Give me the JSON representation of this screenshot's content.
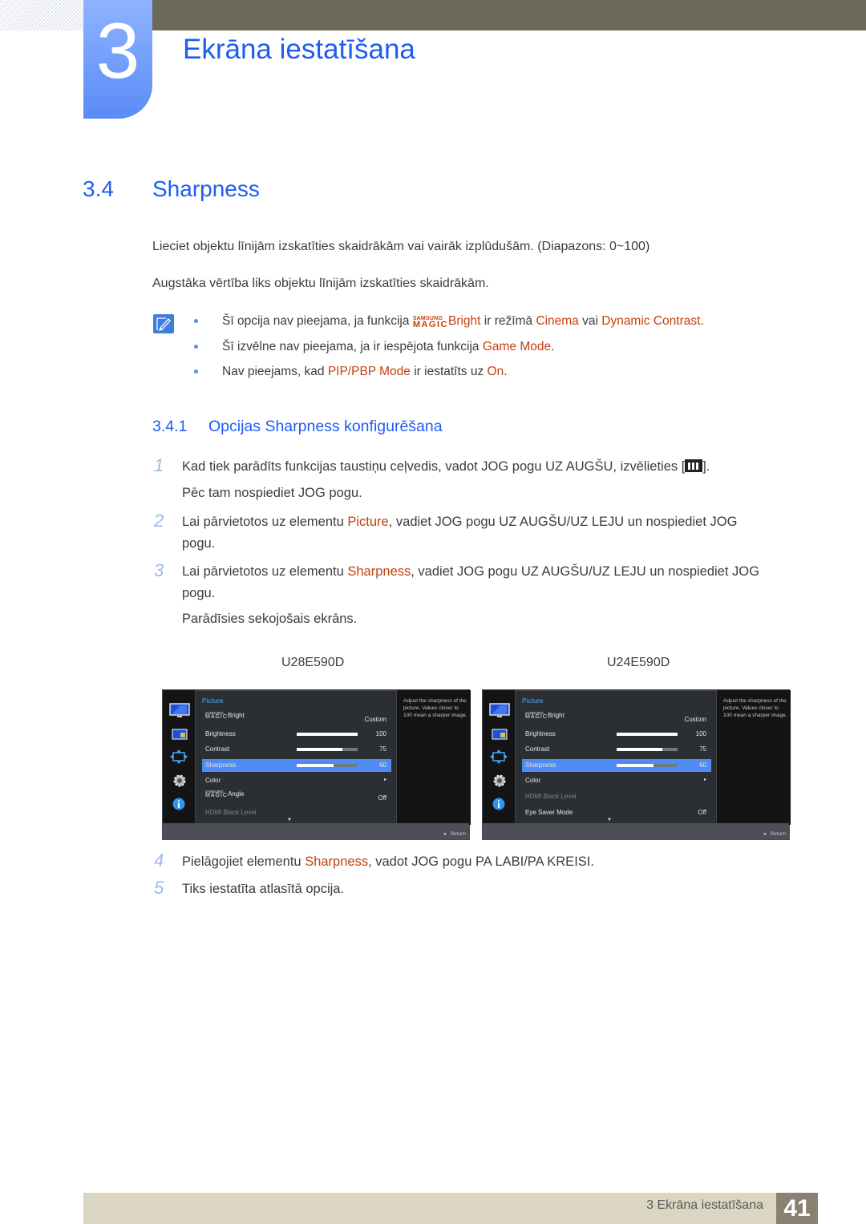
{
  "header": {
    "chapter_number": "3",
    "chapter_title": "Ekrāna iestatīšana"
  },
  "section": {
    "number": "3.4",
    "title": "Sharpness",
    "paragraphs": [
      "Lieciet objektu līnijām izskatīties skaidrākām vai vairāk izplūdušām. (Diapazons: 0~100)",
      "Augstāka vērtība liks objektu līnijām izskatīties skaidrākām."
    ]
  },
  "notes": {
    "icon": "note-pencil-icon",
    "items": [
      {
        "pre": "Šī opcija nav pieejama, ja funkcija ",
        "magic_top": "SAMSUNG",
        "magic_bottom": "MAGIC",
        "hl1": "Bright",
        "mid": " ir režīmā ",
        "hl2": "Cinema",
        "mid2": " vai ",
        "hl3": "Dynamic Contrast",
        "post": "."
      },
      {
        "pre": "Šī izvēlne nav pieejama, ja ir iespējota funkcija ",
        "hl1": "Game Mode",
        "post": "."
      },
      {
        "pre": "Nav pieejams, kad ",
        "hl1": "PIP/PBP Mode",
        "mid": " ir iestatīts uz ",
        "hl2": "On",
        "post": "."
      }
    ]
  },
  "subsection": {
    "number": "3.4.1",
    "title": "Opcijas Sharpness konfigurēšana"
  },
  "steps": [
    {
      "num": "1",
      "line1_pre": "Kad tiek parādīts funkcijas taustiņu ceļvedis, vadot JOG pogu UZ AUGŠU, izvēlieties [",
      "line1_post": "].",
      "line2": "Pēc tam nospiediet JOG pogu."
    },
    {
      "num": "2",
      "pre": "Lai pārvietotos uz elementu ",
      "hl": "Picture",
      "post": ", vadiet JOG pogu UZ AUGŠU/UZ LEJU un nospiediet JOG",
      "line2": "pogu."
    },
    {
      "num": "3",
      "pre": "Lai pārvietotos uz elementu ",
      "hl": "Sharpness",
      "post": ", vadiet JOG pogu UZ AUGŠU/UZ LEJU un nospiediet JOG",
      "line2": "pogu.",
      "line3": "Parādīsies sekojošais ekrāns."
    },
    {
      "num": "4",
      "pre": "Pielāgojiet elementu ",
      "hl": "Sharpness",
      "post": ", vadot JOG pogu PA LABI/PA KREISI."
    },
    {
      "num": "5",
      "text": "Tiks iestatīta atlasītā opcija."
    }
  ],
  "osd_screens": [
    {
      "model": "U28E590D",
      "menu_title": "Picture",
      "help_text": "Adjust the sharpness of the picture. Values closer to 100 mean a sharper image.",
      "return_label": "Return",
      "rows": [
        {
          "magic": true,
          "label": "Bright",
          "value": "Custom"
        },
        {
          "label": "Brightness",
          "value": "100",
          "level": 100
        },
        {
          "label": "Contrast",
          "value": "75",
          "level": 75
        },
        {
          "label": "Sharpness",
          "value": "60",
          "level": 60,
          "selected": true
        },
        {
          "label": "Color",
          "value": "▸"
        },
        {
          "magic": true,
          "label": "Angle",
          "value": "Off"
        },
        {
          "label": "HDMI Black Level",
          "value": "",
          "dimmed": true
        }
      ]
    },
    {
      "model": "U24E590D",
      "menu_title": "Picture",
      "help_text": "Adjust the sharpness of the picture. Values closer to 100 mean a sharper image.",
      "return_label": "Return",
      "rows": [
        {
          "magic": true,
          "label": "Bright",
          "value": "Custom"
        },
        {
          "label": "Brightness",
          "value": "100",
          "level": 100
        },
        {
          "label": "Contrast",
          "value": "75",
          "level": 75
        },
        {
          "label": "Sharpness",
          "value": "60",
          "level": 60,
          "selected": true
        },
        {
          "label": "Color",
          "value": "▸"
        },
        {
          "label": "HDMI Black Level",
          "value": "",
          "dimmed": true
        },
        {
          "label": "Eye Saver Mode",
          "value": "Off"
        }
      ]
    }
  ],
  "osd_common": {
    "magic_top": "SAMSUNG",
    "magic_bottom": "MAGIC",
    "scroll_down": "▼",
    "return_arrow": "◂",
    "side_icons": [
      "monitor-icon",
      "picture-in-picture-icon",
      "resize-arrows-icon",
      "settings-gear-icon",
      "info-icon"
    ]
  },
  "footer": {
    "text": "3 Ekrāna iestatīšana",
    "page": "41"
  },
  "colors": {
    "accent_blue": "#1f5cf2",
    "highlight_orange": "#c4400e",
    "osd_selected": "#4e8cf2"
  }
}
